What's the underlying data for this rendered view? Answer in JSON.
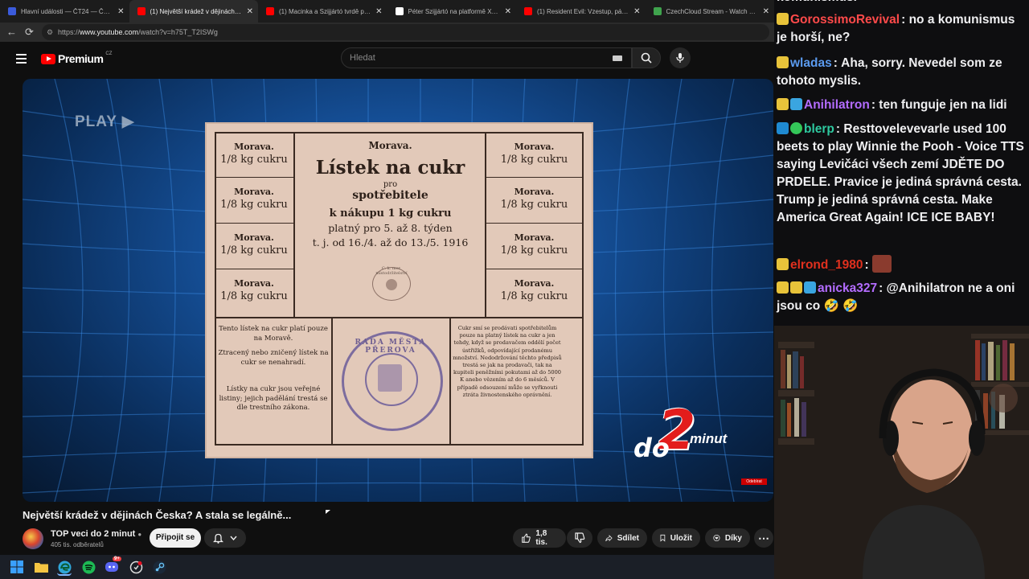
{
  "browser": {
    "tabs": [
      {
        "title": "Hlavní události — ČT24 — Česká",
        "favicon_color": "#3b5bdb",
        "active": false
      },
      {
        "title": "(1) Největší krádež v dějinách Česk",
        "favicon_color": "#ff0000",
        "active": true
      },
      {
        "title": "(1) Macinka a Szijjártó tvrdě proti",
        "favicon_color": "#ff0000",
        "active": false
      },
      {
        "title": "Péter Szijjártó na platformě X: „It h",
        "favicon_color": "#ffffff",
        "active": false
      },
      {
        "title": "(1) Resident Evil: Vzestup, pád a zn",
        "favicon_color": "#ff0000",
        "active": false
      },
      {
        "title": "CzechCloud Stream - Watch Live o",
        "favicon_color": "#3fa34d",
        "active": false
      }
    ],
    "close_glyph": "✕",
    "back_glyph": "←",
    "reload_glyph": "⟳",
    "url_prefix": "https://",
    "url_host": "www.youtube.com",
    "url_path": "/watch?v=h75T_T2ISWg"
  },
  "youtube": {
    "logo_text": "Premium",
    "region": "CZ",
    "search_placeholder": "Hledat",
    "video": {
      "play_overlay": "PLAY ▶",
      "coupon": {
        "side_region": "Morava.",
        "side_amount": "1/8 kg cukru",
        "title_region": "Morava.",
        "title_main": "Lístek na cukr",
        "title_pro": "pro",
        "title_spotrebitele": "spotřebitele",
        "title_nakup": "k nákupu 1 kg cukru",
        "title_platny": "platný pro 5. až 8. týden",
        "title_dates": "t. j. od 16./4. až do 13./5. 1916",
        "mini_stamp": "C. k. mor. místodržitelství",
        "left_text_1": "Tento lístek na cukr platí pouze na Moravě.",
        "left_text_2": "Ztracený nebo zničený lístek na cukr se nenahradí.",
        "left_text_3": "Lístky na cukr jsou veřejné listiny; jejich padělání trestá se dle trestního zákona.",
        "stamp_text": "RADA MĚSTA PŘEROVA",
        "right_text": "Cukr smí se prodávati spotřebitelům pouze na platný lístek na cukr a jen tehdy, když se prodavačem oddělí počet ústřižků, odpovídající prodanému množství. Nedodržování těchto předpisů trestá se jak na prodavači, tak na kupiteli peněžními pokutami až do 5000 K anebo vězením až do 6 měsíců. V případě odsouzení může se vyřknouti ztráta živnostenského oprávnění."
      },
      "logo_do": "do",
      "logo_two": "2",
      "logo_minut": "minut",
      "subscribe_watermark": "Odebírat"
    },
    "title": "Největší krádež v dějinách Česka? A stala se legálně...",
    "channel": {
      "name": "TOP veci do 2 minut",
      "verified_glyph": "●",
      "subscribers": "405 tis. odběratelů",
      "join_label": "Připojit se"
    },
    "actions": {
      "likes": "1,8 tis.",
      "share": "Sdílet",
      "save": "Uložit",
      "thanks": "Díky",
      "more": "⋯"
    }
  },
  "taskbar": {
    "apps": [
      {
        "name": "windows-start",
        "color": "#3aa0ff"
      },
      {
        "name": "file-explorer",
        "color": "#f5c542"
      },
      {
        "name": "edge",
        "color": "#2fa6d8"
      },
      {
        "name": "spotify",
        "color": "#1db954"
      },
      {
        "name": "discord",
        "color": "#5865f2"
      },
      {
        "name": "misc-app",
        "color": "#cccccc"
      },
      {
        "name": "steam",
        "color": "#66c0f4"
      }
    ],
    "discord_badge": "9+"
  },
  "chat": {
    "truncated_top": "komunismus.",
    "messages": [
      {
        "user": "GorossimoRevival",
        "color": "#ff4a4a",
        "text": "no a komunismus je horší, ne?",
        "badges": [
          "#e8c33a"
        ]
      },
      {
        "user": "wladas",
        "color": "#5b9bf0",
        "text": "Aha, sorry. Nevedel som ze tohoto myslis.",
        "badges": [
          "#e8c33a"
        ]
      },
      {
        "user": "Anihilatron",
        "color": "#b36cff",
        "text": "ten funguje jen na lidi",
        "badges": [
          "#e8c33a",
          "#3aa5e0"
        ]
      },
      {
        "user": "blerp",
        "color": "#2ec9a0",
        "text": "Resttovelevevarle used 100 beets to play Winnie the Pooh - Voice TTS saying Levičáci všech zemí JDĚTE DO PRDELE. Pravice je jediná správná cesta. Trump je jediná správná cesta. Make America Great Again! ICE ICE BABY!",
        "badges": [
          "#1f8ad1",
          "#34c759"
        ]
      },
      {
        "user": "elrond_1980",
        "color": "#e0301e",
        "text": "",
        "badges": [
          "#e8c33a"
        ],
        "emote_color": "#8a3b2e"
      },
      {
        "user": "anicka327",
        "color": "#b36cff",
        "text": "@Anihilatron ne a oni jsou co 🤣 🤣",
        "badges": [
          "#e8c33a",
          "#e8c33a",
          "#3aa5e0"
        ]
      }
    ]
  }
}
